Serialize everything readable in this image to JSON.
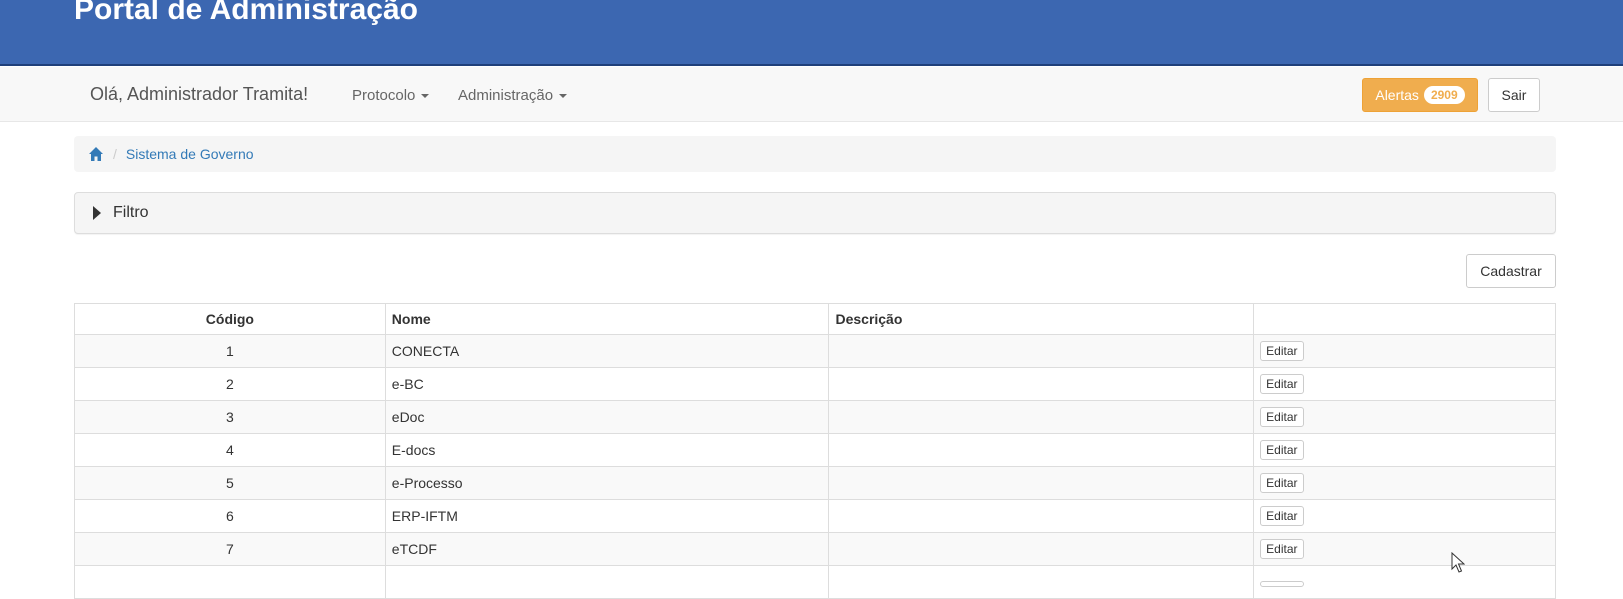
{
  "header": {
    "title": "Portal de Administração"
  },
  "navbar": {
    "greeting": "Olá, Administrador Tramita!",
    "menus": [
      {
        "label": "Protocolo"
      },
      {
        "label": "Administração"
      }
    ],
    "alerts": {
      "label": "Alertas",
      "count": "2909"
    },
    "logout_label": "Sair"
  },
  "breadcrumb": {
    "items": [
      "Sistema de Governo"
    ]
  },
  "filter": {
    "label": "Filtro"
  },
  "actions": {
    "create_label": "Cadastrar"
  },
  "table": {
    "columns": [
      "Código",
      "Nome",
      "Descrição",
      ""
    ],
    "rows": [
      {
        "codigo": "1",
        "nome": "CONECTA",
        "descricao": "",
        "action": "Editar"
      },
      {
        "codigo": "2",
        "nome": "e-BC",
        "descricao": "",
        "action": "Editar"
      },
      {
        "codigo": "3",
        "nome": "eDoc",
        "descricao": "",
        "action": "Editar"
      },
      {
        "codigo": "4",
        "nome": "E-docs",
        "descricao": "",
        "action": "Editar"
      },
      {
        "codigo": "5",
        "nome": "e-Processo",
        "descricao": "",
        "action": "Editar"
      },
      {
        "codigo": "6",
        "nome": "ERP-IFTM",
        "descricao": "",
        "action": "Editar"
      },
      {
        "codigo": "7",
        "nome": "eTCDF",
        "descricao": "",
        "action": "Editar"
      },
      {
        "codigo": "",
        "nome": "",
        "descricao": "",
        "action": ""
      }
    ]
  },
  "colors": {
    "header_bg": "#3c67b1",
    "alert_bg": "#f0ad4e",
    "link": "#337ab7"
  }
}
